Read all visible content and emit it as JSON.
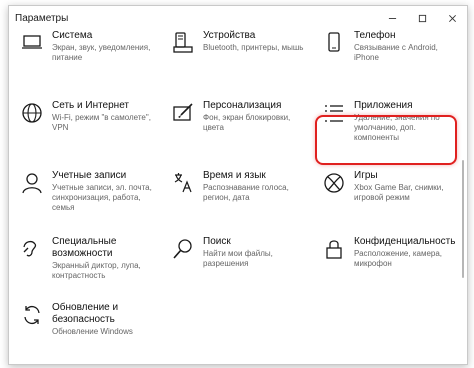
{
  "window": {
    "title": "Параметры",
    "controls": [
      "minimize",
      "maximize",
      "close"
    ]
  },
  "tiles": [
    {
      "name": "Система",
      "desc": [
        "Экран, звук, уведомления,",
        "питание"
      ],
      "icon": "laptop-icon"
    },
    {
      "name": "Устройства",
      "desc": [
        "Bluetooth, принтеры, мышь"
      ],
      "icon": "keyboard-icon"
    },
    {
      "name": "Телефон",
      "desc": [
        "Связывание с Android,",
        "iPhone"
      ],
      "icon": "phone-icon"
    },
    {
      "name": "Сеть и Интернет",
      "desc": [
        "Wi-Fi, режим \"в самолете\",",
        "VPN"
      ],
      "icon": "globe-icon"
    },
    {
      "name": "Персонализация",
      "desc": [
        "Фон, экран блокировки, цвета"
      ],
      "icon": "paintbrush-icon"
    },
    {
      "name": "Приложения",
      "desc": [
        "Удаление, значения по",
        "умолчанию, доп. компоненты"
      ],
      "icon": "app-list-icon"
    },
    {
      "name": "Учетные записи",
      "desc": [
        "Учетные записи, эл. почта,",
        "синхронизация, работа, семья"
      ],
      "icon": "person-icon"
    },
    {
      "name": "Время и язык",
      "desc": [
        "Распознавание голоса,",
        "регион, дата"
      ],
      "icon": "time-language-icon"
    },
    {
      "name": "Игры",
      "desc": [
        "Xbox Game Bar, снимки,",
        "игровой режим"
      ],
      "icon": "xbox-icon"
    },
    {
      "name": "Специальные",
      "name2": "возможности",
      "desc": [
        "Экранный диктор, лупа,",
        "контрастность"
      ],
      "icon": "accessibility-icon"
    },
    {
      "name": "Поиск",
      "desc": [
        "Найти мои файлы,",
        "разрешения"
      ],
      "icon": "search-icon"
    },
    {
      "name": "Конфиденциальность",
      "desc": [
        "Расположение, камера,",
        "микрофон"
      ],
      "icon": "lock-icon"
    },
    {
      "name": "Обновление и",
      "name2": "безопасность",
      "desc": [
        "Обновление Windows"
      ],
      "icon": "sync-icon"
    }
  ],
  "colors": {
    "highlight": "#e0201f",
    "icon_stroke": "#1a1a1a"
  }
}
